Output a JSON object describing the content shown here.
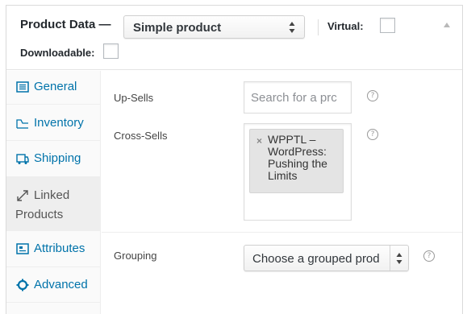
{
  "header": {
    "title": "Product Data —",
    "product_type": {
      "selected": "Simple product",
      "options": [
        "Simple product"
      ]
    },
    "virtual_label": "Virtual:",
    "virtual_checked": false,
    "downloadable_label": "Downloadable:",
    "downloadable_checked": false
  },
  "tabs": [
    {
      "label": "General",
      "icon": "general-icon",
      "active": false
    },
    {
      "label": "Inventory",
      "icon": "inventory-icon",
      "active": false
    },
    {
      "label": "Shipping",
      "icon": "shipping-icon",
      "active": false
    },
    {
      "label_line1": "Linked",
      "label_line2": "Products",
      "icon": "link-icon",
      "active": true
    },
    {
      "label": "Attributes",
      "icon": "attributes-icon",
      "active": false
    },
    {
      "label": "Advanced",
      "icon": "advanced-icon",
      "active": false
    }
  ],
  "linked": {
    "upsells_label": "Up-Sells",
    "upsells_placeholder": "Search for a prc",
    "crosssells_label": "Cross-Sells",
    "crosssells_items": [
      {
        "text": "WPPTL – WordPress: Pushing the Limits",
        "remove": "×"
      }
    ],
    "grouping_label": "Grouping",
    "grouping_selected": "Choose a grouped prod",
    "help_symbol": "?"
  },
  "colors": {
    "link": "#0073aa",
    "active_tab_bg": "#eeeeee",
    "border": "#dadada"
  }
}
